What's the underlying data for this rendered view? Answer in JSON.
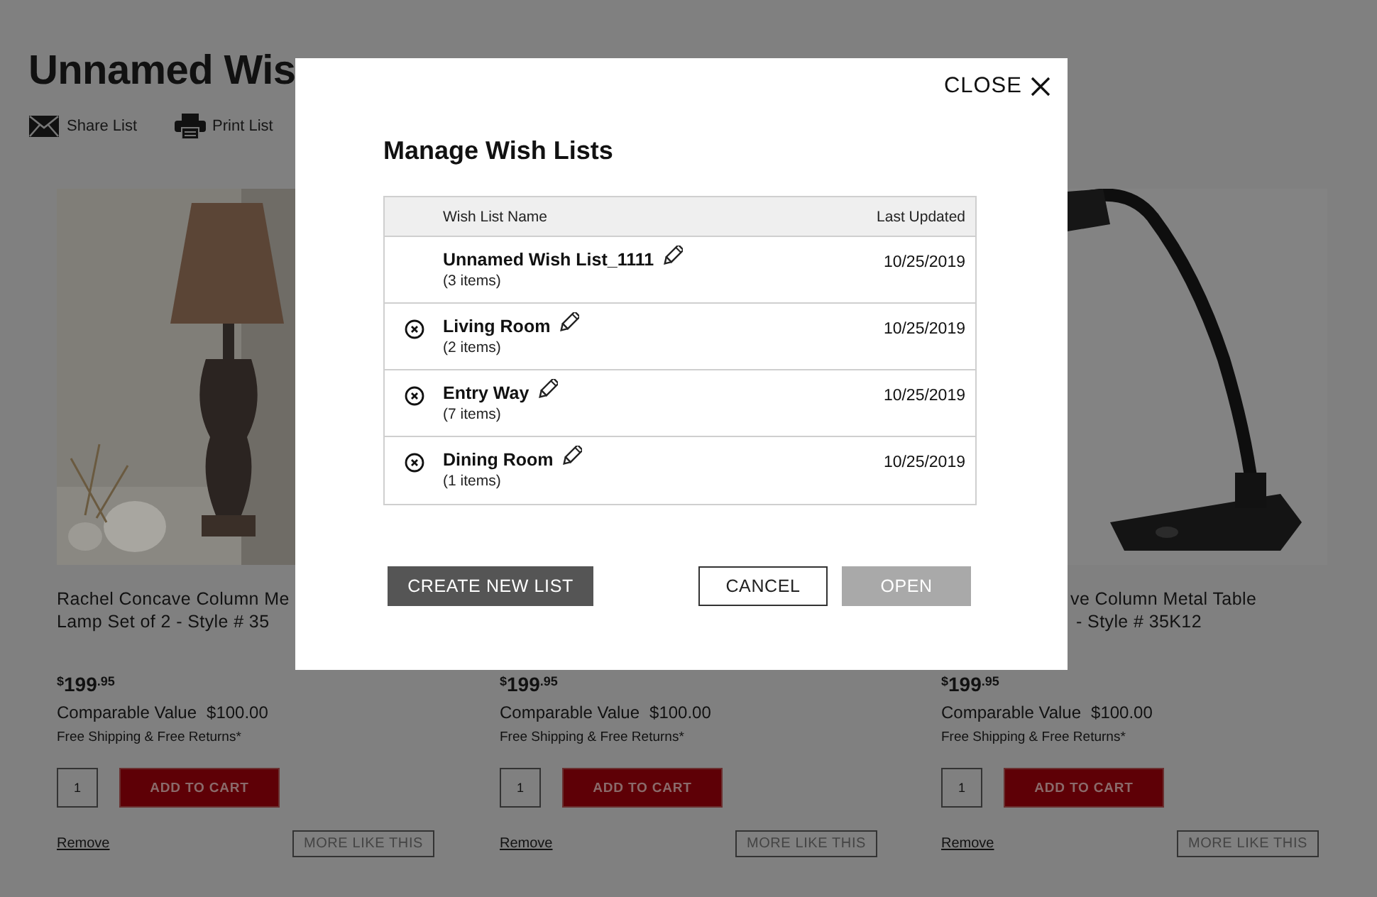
{
  "page": {
    "title": "Unnamed Wis",
    "actions": [
      {
        "kind": "share",
        "label": "Share List"
      },
      {
        "kind": "print",
        "label": "Print List"
      }
    ],
    "products": [
      {
        "image": {
          "kind": "picture"
        },
        "title_lines": [
          "Rachel Concave Column Me",
          "Lamp Set of 2 - Style # 35"
        ],
        "currency": "$",
        "price": "199",
        "cents": ".95",
        "comparable_label": "Comparable Value",
        "comparable_value": "$100.00",
        "shipping": "Free Shipping & Free Returns*",
        "quantity": "1",
        "add_label": "ADD TO CART",
        "remove_label": "Remove",
        "more_label": "MORE LIKE THIS"
      },
      {
        "currency": "$",
        "price": "199",
        "cents": ".95",
        "comparable_label": "Comparable Value",
        "comparable_value": "$100.00",
        "shipping": "Free Shipping & Free Returns*",
        "quantity": "1",
        "add_label": "ADD TO CART",
        "remove_label": "Remove",
        "more_label": "MORE LIKE THIS"
      },
      {
        "image": {
          "kind": "picture"
        },
        "title_lines": [
          "ve Column Metal Table",
          "- Style # 35K12"
        ],
        "currency": "$",
        "price": "199",
        "cents": ".95",
        "comparable_label": "Comparable Value",
        "comparable_value": "$100.00",
        "shipping": "Free Shipping & Free Returns*",
        "quantity": "1",
        "add_label": "ADD TO CART",
        "remove_label": "Remove",
        "more_label": "MORE LIKE THIS"
      }
    ]
  },
  "modal": {
    "close_label": "CLOSE",
    "title": "Manage Wish Lists",
    "table": {
      "columns": [
        "Wish List Name",
        "Last Updated"
      ],
      "rows": [
        {
          "name": "Unnamed Wish List_1111",
          "count": "(3 items)",
          "updated": "10/25/2019",
          "removable": false
        },
        {
          "name": "Living Room",
          "count": "(2 items)",
          "updated": "10/25/2019",
          "removable": true
        },
        {
          "name": "Entry Way",
          "count": "(7 items)",
          "updated": "10/25/2019",
          "removable": true
        },
        {
          "name": "Dining Room",
          "count": "(1 items)",
          "updated": "10/25/2019",
          "removable": true
        }
      ]
    },
    "buttons": [
      {
        "kind": "create",
        "label": "CREATE NEW LIST",
        "disabled": false
      },
      {
        "kind": "cancel",
        "label": "CANCEL",
        "disabled": false
      },
      {
        "kind": "open",
        "label": "OPEN",
        "disabled": true
      }
    ]
  }
}
